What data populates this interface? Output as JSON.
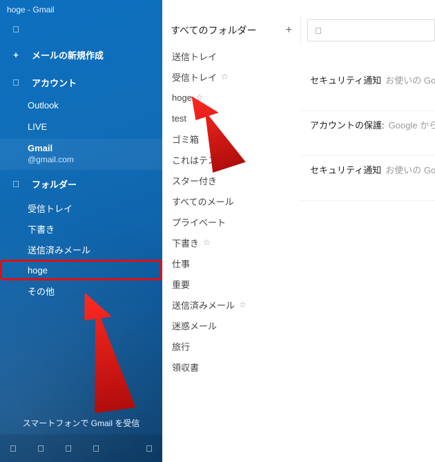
{
  "title": "hoge - Gmail",
  "compose": "メールの新規作成",
  "accounts_label": "アカウント",
  "accounts": [
    {
      "name": "Outlook",
      "sub": ""
    },
    {
      "name": "LIVE",
      "sub": ""
    },
    {
      "name": "Gmail",
      "sub": "@gmail.com"
    }
  ],
  "folders_label": "フォルダー",
  "folders": [
    {
      "label": "受信トレイ"
    },
    {
      "label": "下書き"
    },
    {
      "label": "送信済みメール"
    },
    {
      "label": "hoge"
    },
    {
      "label": "その他"
    }
  ],
  "promo": "スマートフォンで Gmail を受信",
  "folder_panel": {
    "header": "すべてのフォルダー",
    "items": [
      {
        "label": "送信トレイ",
        "star": false
      },
      {
        "label": "受信トレイ",
        "star": true
      },
      {
        "label": "hoge",
        "star": true
      },
      {
        "label": "test",
        "star": false
      },
      {
        "label": "ゴミ箱",
        "star": false
      },
      {
        "label": "これはテスト",
        "star": false
      },
      {
        "label": "スター付き",
        "star": false
      },
      {
        "label": "すべてのメール",
        "star": false
      },
      {
        "label": "プライベート",
        "star": false
      },
      {
        "label": "下書き",
        "star": true
      },
      {
        "label": "仕事",
        "star": false
      },
      {
        "label": "重要",
        "star": false
      },
      {
        "label": "送信済みメール",
        "star": true
      },
      {
        "label": "迷惑メール",
        "star": false
      },
      {
        "label": "旅行",
        "star": false
      },
      {
        "label": "領収書",
        "star": false
      }
    ]
  },
  "mail_list": [
    {
      "title": "セキュリティ通知",
      "preview": "お使いの Google ア"
    },
    {
      "title": "アカウントの保護:",
      "preview": "Google からのセキ"
    },
    {
      "title": "セキュリティ通知",
      "preview": "お使いの Google ア"
    }
  ],
  "glyphs": {
    "menu": "",
    "plus": "+",
    "person": "",
    "folder": "",
    "mail": "",
    "calendar": "",
    "people": "",
    "check": "",
    "gear": "",
    "search": "",
    "star": "☆"
  }
}
